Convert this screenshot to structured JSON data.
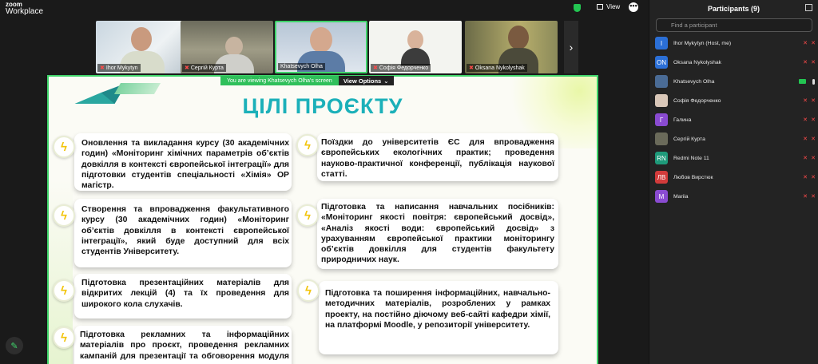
{
  "app": {
    "brand_line1": "zoom",
    "brand_line2": "Workplace"
  },
  "toolbar": {
    "view_label": "View",
    "more_label": "•••"
  },
  "thumbnails": [
    {
      "name": "Ihor Mykytyn",
      "muted": true
    },
    {
      "name": "Сергій Курта",
      "muted": true
    },
    {
      "name": "Khatsevych Olha",
      "muted": false
    },
    {
      "name": "Софія Федорченко",
      "muted": true
    },
    {
      "name": "Oksana Nykolyshak",
      "muted": true
    }
  ],
  "banner": {
    "text": "You are viewing  Khatsevych Olha's screen",
    "options_label": "View Options"
  },
  "slide": {
    "title": "ЦІЛІ ПРОЄКТУ",
    "cards": [
      "Оновлення та викладання курсу (30 академічних годин) «Моніторинг хімічних параметрів об’єктів довкілля в контексті європейської інтеграції» для підготовки студентів спеціальності «Хімія» ОР магістр.",
      "Створення та впровадження факультативного курсу (30 академічних годин) «Моніторинг об’єктів довкілля в контексті європейської інтеграції», який буде доступний для всіх студентів Університету.",
      "Підготовка презентаційних матеріалів для відкритих лекцій (4) та їх проведення для широкого кола слухачів.",
      "Підготовка рекламних та інформаційних матеріалів про проєкт, проведення рекламних кампаній для презентації та обговорення модуля з",
      "Поїздки до університетів ЄС для впровадження європейських екологічних практик; проведення науково-практичної конференції, публікація наукової статті.",
      "Підготовка та написання навчальних посібників: «Моніторинг якості повітря: європейський досвід», «Аналіз якості води: європейський досвід» з урахуванням європейської практики моніторингу об’єктів довкілля для студентів факультету природничих наук.",
      "Підготовка та поширення інформаційних, навчально-методичних матеріалів, розроблених у рамках проекту, на постійно діючому веб-сайті кафедри хімії, на платформі Moodle, у репозиторії університету."
    ]
  },
  "participants": {
    "title": "Participants (9)",
    "search_placeholder": "Find a participant",
    "list": [
      {
        "avatar": "I",
        "color": "#2b6fd6",
        "name": "Ihor Mykytyn (Host, me)",
        "state": "off"
      },
      {
        "avatar": "ON",
        "color": "#2b6fd6",
        "name": "Oksana Nykolyshak",
        "state": "off"
      },
      {
        "avatar": "",
        "color": "#4a6b95",
        "name": "Khatsevych Olha",
        "state": "on"
      },
      {
        "avatar": "",
        "color": "#d9c7b8",
        "name": "Софія Федорченко",
        "state": "off"
      },
      {
        "avatar": "Г",
        "color": "#8a4bd1",
        "name": "Галина",
        "state": "off"
      },
      {
        "avatar": "",
        "color": "#6a6a5a",
        "name": "Сергій Курта",
        "state": "off"
      },
      {
        "avatar": "RN",
        "color": "#1e9a7a",
        "name": "Redmi Note 11",
        "state": "off"
      },
      {
        "avatar": "ЛВ",
        "color": "#d23b3b",
        "name": "Любов Вирстюк",
        "state": "off"
      },
      {
        "avatar": "M",
        "color": "#8a4bd1",
        "name": "Mariia",
        "state": "off"
      }
    ]
  }
}
